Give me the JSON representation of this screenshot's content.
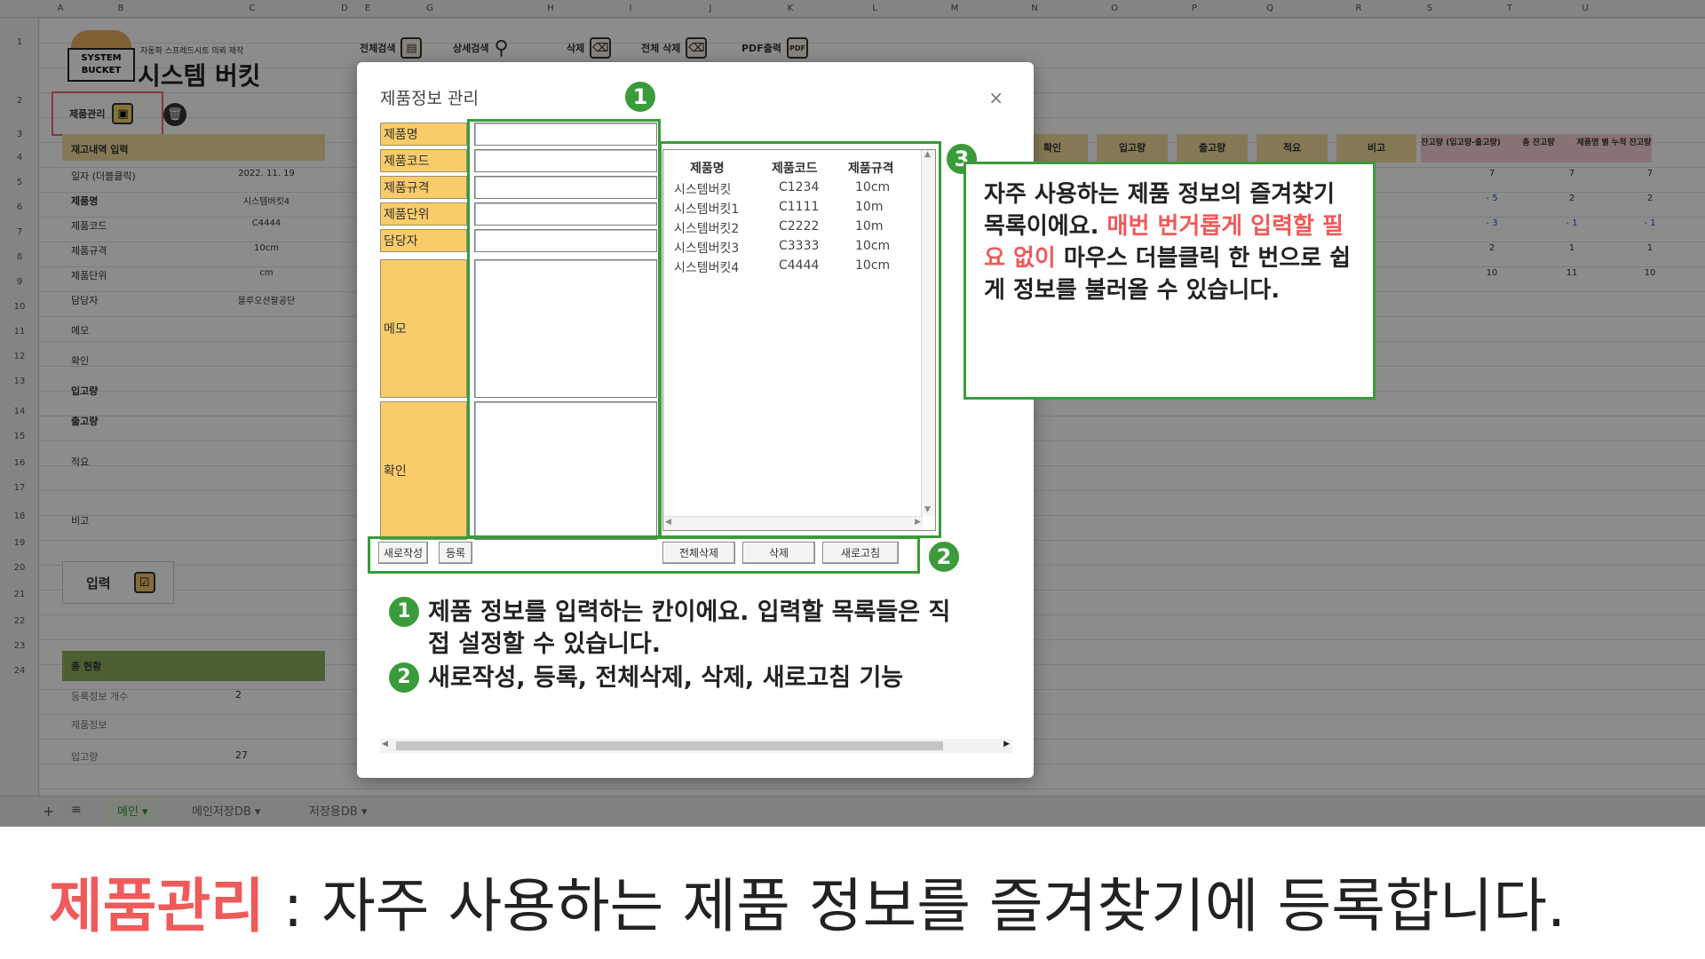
{
  "toolbar": {
    "search_all": "전체검색",
    "search_detail": "상세검색",
    "delete": "삭제",
    "delete_all": "전체 삭제",
    "pdf": "PDF출력"
  },
  "logo": {
    "tagline": "자동화 스프레드시트 의뢰 제작",
    "name": "시스템 버킷",
    "mark": "SYSTEM BUCKET"
  },
  "sheet": {
    "product_mgmt_label": "제품관리",
    "inventory_header": "재고내역 입력",
    "rows": [
      {
        "label": "일자 (더블클릭)",
        "value": "2022. 11. 19"
      },
      {
        "label": "제품명",
        "value": "시스템버킷4"
      },
      {
        "label": "제품코드",
        "value": "C4444"
      },
      {
        "label": "제품규격",
        "value": "10cm"
      },
      {
        "label": "제품단위",
        "value": "cm"
      },
      {
        "label": "담당자",
        "value": "블루오션팔공단"
      },
      {
        "label": "메모",
        "value": ""
      },
      {
        "label": "확인",
        "value": ""
      },
      {
        "label": "입고량",
        "value": ""
      },
      {
        "label": "출고량",
        "value": ""
      },
      {
        "label": "적요",
        "value": ""
      },
      {
        "label": "비고",
        "value": ""
      }
    ],
    "input_button": "입력",
    "total_header": "총 현황",
    "totals": [
      {
        "label": "등록정보 개수",
        "value": "2"
      },
      {
        "label": "제품정보",
        "value": ""
      },
      {
        "label": "입고량",
        "value": "27"
      }
    ],
    "right_headers": [
      "확인",
      "입고량",
      "출고량",
      "적요",
      "비고",
      "잔고량 (입고량-출고량)",
      "총 잔고량",
      "제품명 별 누적 잔고량"
    ],
    "right_rows": [
      [
        "7",
        "7",
        "7"
      ],
      [
        "- 5",
        "2",
        "2"
      ],
      [
        "- 3",
        "- 1",
        "- 1"
      ],
      [
        "2",
        "1",
        "1"
      ],
      [
        "10",
        "11",
        "10"
      ]
    ],
    "columns": [
      "A",
      "B",
      "C",
      "D",
      "E",
      "G",
      "H",
      "I",
      "J",
      "K",
      "L",
      "M",
      "N",
      "O",
      "P",
      "Q",
      "R",
      "S",
      "T",
      "U"
    ],
    "row_numbers": [
      "1",
      "2",
      "3",
      "4",
      "5",
      "6",
      "7",
      "8",
      "9",
      "10",
      "11",
      "12",
      "13",
      "14",
      "15",
      "16",
      "17",
      "18",
      "19",
      "20",
      "21",
      "22",
      "23",
      "24"
    ]
  },
  "sheet_tabs": [
    "메인",
    "메인저장DB",
    "저장용DB"
  ],
  "dialog": {
    "title": "제품정보 관리",
    "close": "×",
    "fields": [
      "제품명",
      "제품코드",
      "제품규격",
      "제품단위",
      "담당자",
      "메모",
      "확인"
    ],
    "list": {
      "headers": [
        "제품명",
        "제품코드",
        "제품규격"
      ],
      "rows": [
        [
          "시스템버킷",
          "C1234",
          "10cm"
        ],
        [
          "시스템버킷1",
          "C1111",
          "10m"
        ],
        [
          "시스템버킷2",
          "C2222",
          "10m"
        ],
        [
          "시스템버킷3",
          "C3333",
          "10cm"
        ],
        [
          "시스템버킷4",
          "C4444",
          "10cm"
        ]
      ]
    },
    "buttons": {
      "new": "새로작성",
      "register": "등록",
      "delete_all": "전체삭제",
      "delete": "삭제",
      "refresh": "새로고침"
    },
    "notes": [
      {
        "badge": "1",
        "text": "제품 정보를 입력하는 칸이에요. 입력할 목록들은 직접 설정할 수 있습니다."
      },
      {
        "badge": "2",
        "text": "새로작성, 등록, 전체삭제, 삭제, 새로고침 기능"
      }
    ]
  },
  "badges": [
    "1",
    "2",
    "3"
  ],
  "callout": {
    "part1": "자주 사용하는 제품 정보의 즐겨찾기 목록이에요. ",
    "highlight": "매번 번거롭게 입력할 필요 없이",
    "part2": " 마우스 더블클릭 한 번으로 쉽게 정보를 불러올 수 있습니다."
  },
  "caption": {
    "highlight": "제품관리",
    "text": " : 자주 사용하는 제품 정보를 즐겨찾기에 등록합니다."
  },
  "colors": {
    "accent_green": "#3a9b3a",
    "highlight_red": "#ef5a5a",
    "label_orange": "#f9cc6a",
    "header_tan": "#f3dc9c",
    "header_green": "#8bb05f",
    "header_pink": "#f6d0d6"
  }
}
